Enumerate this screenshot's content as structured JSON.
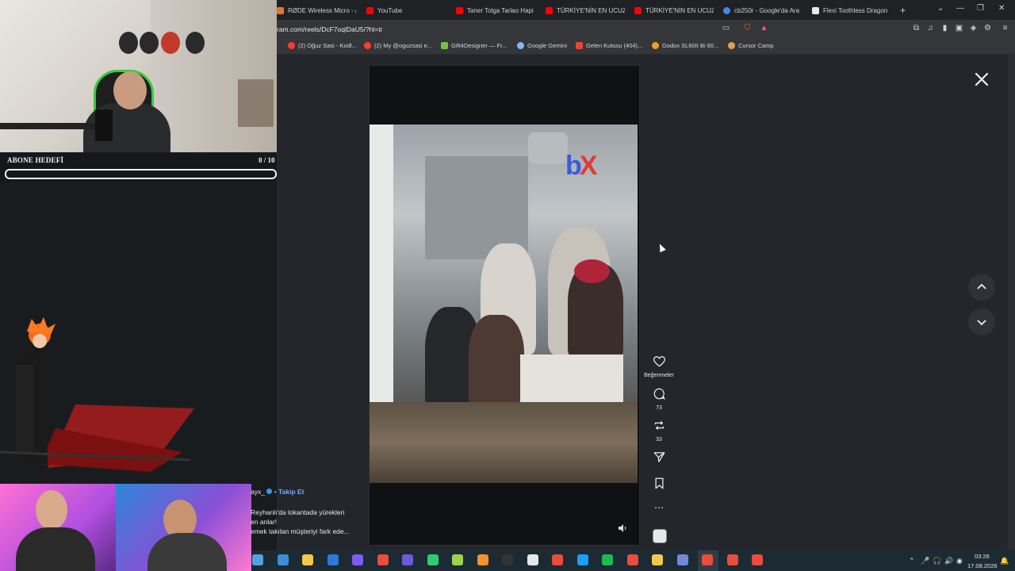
{
  "overlay": {
    "goal_label": "ABONE HEDEFİ",
    "goal_value": "0 / 10",
    "goal_progress": 0.0
  },
  "browser": {
    "tabs": [
      {
        "label": "RØDE Wireless Micro - A",
        "favicon_color": "#e8742a"
      },
      {
        "label": "YouTube",
        "favicon_color": "#ff0000"
      },
      {
        "label": "Taner Tolga Tarlao Hapis",
        "favicon_color": "#ff0000"
      },
      {
        "label": "TÜRKİYE'NİN EN UCUZ",
        "favicon_color": "#ff0000"
      },
      {
        "label": "TÜRKİYE'NİN EN UCUZ",
        "favicon_color": "#ff0000"
      },
      {
        "label": "cb250r - Google'da Ara",
        "favicon_color": "#4285f4"
      },
      {
        "label": "Flexi Toothless Dragon",
        "favicon_color": "#e8e8e8"
      }
    ],
    "url": "ram.com/reels/DcF7oqlDaU5/?hl=tr",
    "bookmarks": [
      {
        "label": "(2) Oğuz Sasi - Kodl...",
        "favicon_color": "#ff3b30"
      },
      {
        "label": "(2) My @oguzsasi e...",
        "favicon_color": "#ff3b30"
      },
      {
        "label": "Gift4Designer — Fr...",
        "favicon_color": "#7ac143"
      },
      {
        "label": "Google Gemini",
        "favicon_color": "#8ab4f8"
      },
      {
        "label": "Gelen Kutusu (404)...",
        "favicon_color": "#ea4335"
      },
      {
        "label": "Godox SL60II Bi 60...",
        "favicon_color": "#f0a020"
      },
      {
        "label": "Cursor Camp",
        "favicon_color": "#d9a35b"
      }
    ]
  },
  "reel": {
    "watermark": "bX",
    "watermark_colors": {
      "b": "#3a5bd9",
      "x": "#e23a3a"
    },
    "username": "ayx_",
    "follow_label": "• Takip Et",
    "caption_lines": [
      "Reyhanlı'da lokantada yürekleri",
      "en anlar!",
      "emek takılan müşteriyi fark ede..."
    ],
    "actions": {
      "like_label": "Beğenmeler",
      "comments_count": "73",
      "reposts_count": "33"
    }
  },
  "taskbar": {
    "time": "03:26",
    "date": "17.08.2026",
    "app_icon_colors": [
      "#4fa3e0",
      "#3a8fd6",
      "#f2c94c",
      "#2b7bd6",
      "#7f5af0",
      "#e84d3d",
      "#6b5bd6",
      "#2ecc71",
      "#9bd34f",
      "#f0932b",
      "#333333",
      "#e8e8e8",
      "#e84d3d",
      "#1a9fff",
      "#1db954",
      "#e84d3d",
      "#f2c94c",
      "#7289da",
      "#e84d3d",
      "#e84d3d",
      "#e84d3d"
    ]
  }
}
